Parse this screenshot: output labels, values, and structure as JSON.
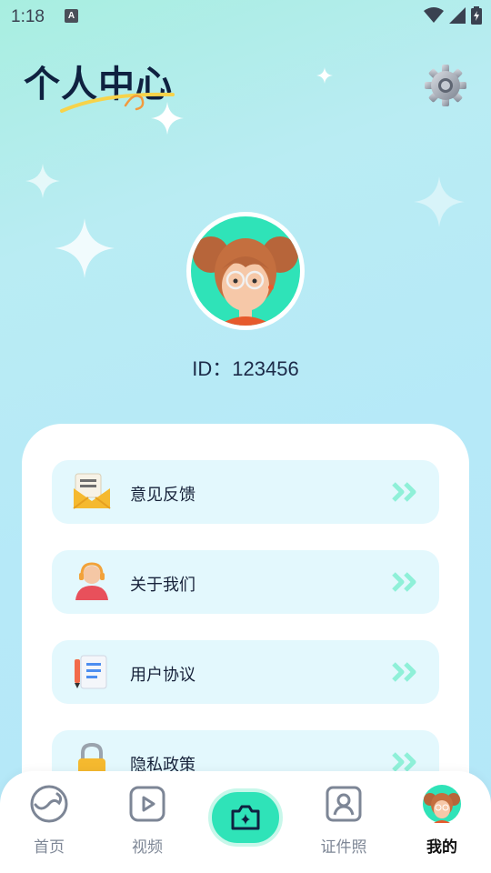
{
  "status_bar": {
    "time": "1:18",
    "notification_letter": "A"
  },
  "header": {
    "title": "个人中心"
  },
  "profile": {
    "id_text": "ID：123456"
  },
  "menu": {
    "items": [
      {
        "label": "意见反馈",
        "icon": "envelope-icon"
      },
      {
        "label": "关于我们",
        "icon": "customer-service-icon"
      },
      {
        "label": "用户协议",
        "icon": "document-icon"
      },
      {
        "label": "隐私政策",
        "icon": "lock-icon"
      }
    ]
  },
  "bottom_nav": {
    "items": [
      {
        "label": "首页",
        "icon": "home-swirl-icon"
      },
      {
        "label": "视频",
        "icon": "video-play-icon"
      },
      {
        "label": "",
        "icon": "camera-icon"
      },
      {
        "label": "证件照",
        "icon": "id-photo-icon"
      },
      {
        "label": "我的",
        "icon": "avatar-icon",
        "active": true
      }
    ]
  },
  "colors": {
    "accent": "#2fe3b8",
    "menu_item_bg": "#e3f8fd",
    "title": "#0f2140"
  }
}
